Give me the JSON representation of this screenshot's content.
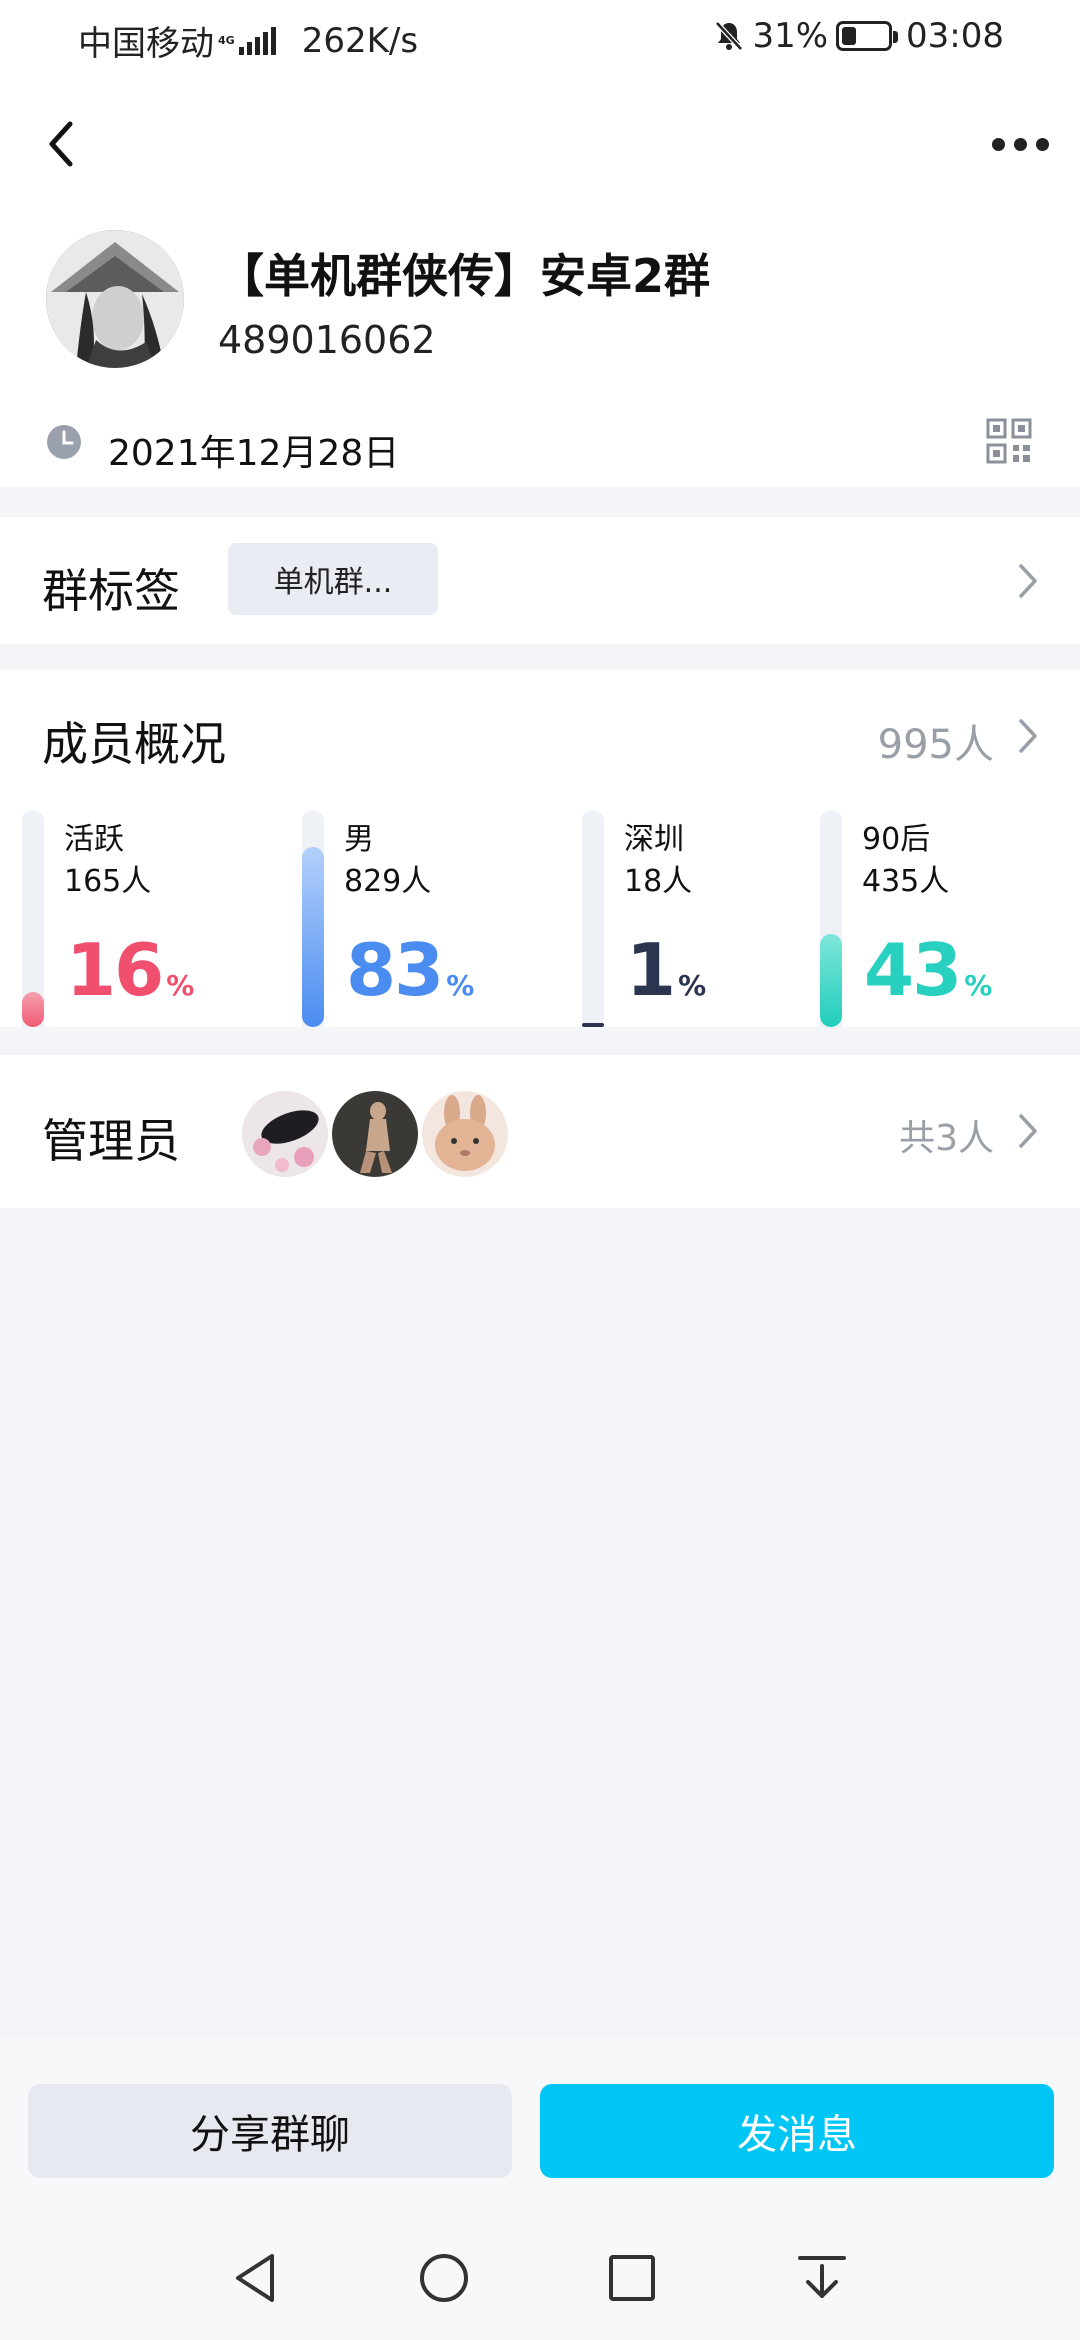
{
  "status_bar": {
    "carrier": "中国移动",
    "network": "4G",
    "speed": "262K/s",
    "battery": "31%",
    "battery_level": 0.31,
    "time": "03:08"
  },
  "header": {
    "group_name": "【单机群侠传】安卓2群",
    "group_id": "489016062",
    "created_date": "2021年12月28日"
  },
  "tags": {
    "title": "群标签",
    "chip": "单机群..."
  },
  "members": {
    "title": "成员概况",
    "count": "995人",
    "stats": [
      {
        "label": "活跃",
        "sub": "165人",
        "percent": "16",
        "fraction": 0.16,
        "color": "#f0506e"
      },
      {
        "label": "男",
        "sub": "829人",
        "percent": "83",
        "fraction": 0.83,
        "color": "#4a8cf0"
      },
      {
        "label": "深圳",
        "sub": "18人",
        "percent": "1",
        "fraction": 0.01,
        "color": "#2c3550"
      },
      {
        "label": "90后",
        "sub": "435人",
        "percent": "43",
        "fraction": 0.43,
        "color": "#28d0c0"
      }
    ],
    "percent_sign": "%"
  },
  "admins": {
    "title": "管理员",
    "total": "共3人"
  },
  "actions": {
    "share": "分享群聊",
    "send": "发消息"
  },
  "icons": {
    "back": "back-arrow-icon",
    "more": "more-icon",
    "clock": "clock-icon",
    "qr": "qr-code-icon",
    "chevron": "chevron-right-icon",
    "mute": "bell-off-icon",
    "signal": "signal-icon",
    "battery": "battery-icon"
  }
}
